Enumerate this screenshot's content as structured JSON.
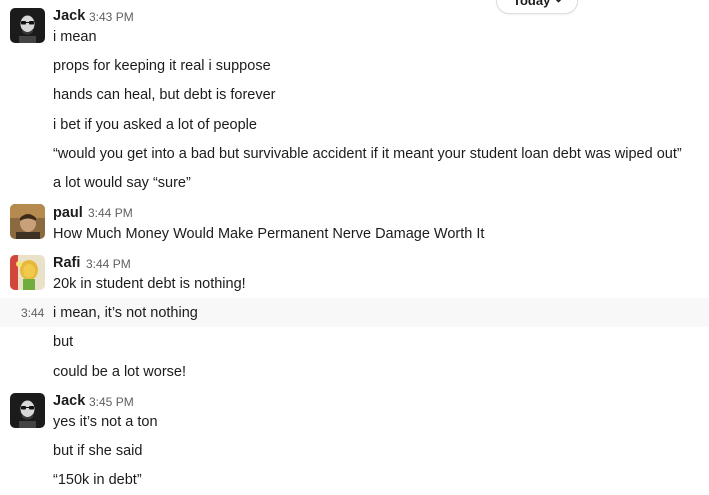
{
  "day_divider": {
    "label": "Today",
    "icon": "chevron-down-icon"
  },
  "groups": [
    {
      "sender": "Jack",
      "time": "3:43 PM",
      "avatar": "jack-avatar",
      "messages": [
        "i mean",
        "props for keeping it real i suppose",
        "hands can heal, but debt is forever",
        "i bet if you asked a lot of people",
        "“would you get into a bad but survivable accident if it meant your student loan debt was wiped out”",
        "a lot would say “sure”"
      ]
    },
    {
      "sender": "paul",
      "time": "3:44 PM",
      "avatar": "paul-avatar",
      "messages": [
        "How Much Money Would Make Permanent Nerve Damage Worth It"
      ]
    },
    {
      "sender": "Rafi",
      "time": "3:44 PM",
      "avatar": "rafi-avatar",
      "messages": [
        "20k in student debt is nothing!",
        "i mean, it’s not nothing",
        "but",
        "could be a lot worse!"
      ],
      "hover_time": "3:44"
    },
    {
      "sender": "Jack",
      "time": "3:45 PM",
      "avatar": "jack-avatar",
      "messages": [
        "yes it’s not a ton",
        "but if she said",
        "“150k in debt”"
      ]
    }
  ]
}
